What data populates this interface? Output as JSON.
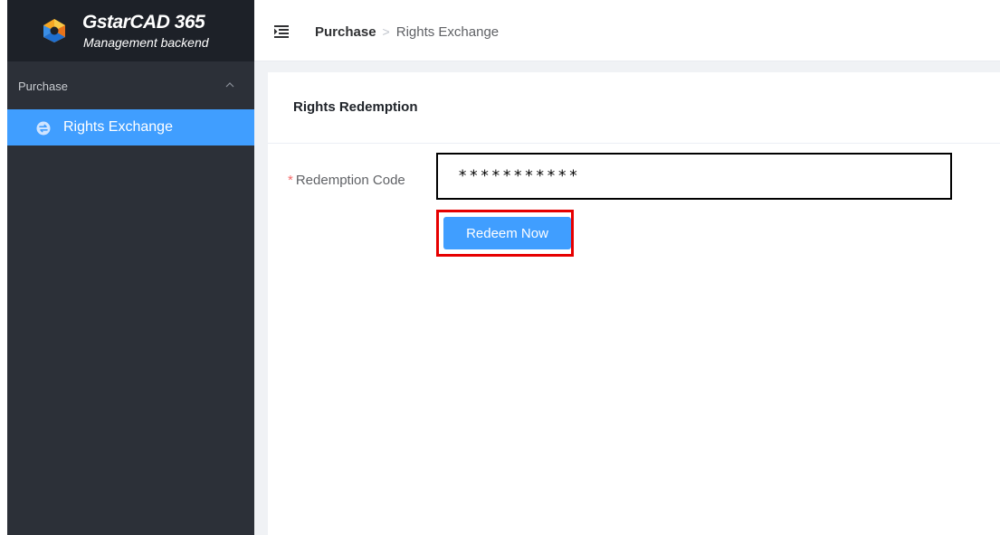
{
  "brand": {
    "title": "GstarCAD 365",
    "subtitle": "Management backend",
    "logo_icon": "gstarcad-logo-icon"
  },
  "sidebar": {
    "group": {
      "label": "Purchase",
      "icon": "chevron-up-icon",
      "expanded": true
    },
    "items": [
      {
        "label": "Rights Exchange",
        "icon": "exchange-icon",
        "active": true
      }
    ]
  },
  "header": {
    "menu_icon": "menu-fold-icon",
    "breadcrumb": {
      "root": "Purchase",
      "separator": ">",
      "current": "Rights Exchange"
    }
  },
  "card": {
    "title": "Rights Redemption"
  },
  "form": {
    "required_mark": "*",
    "code_label": "Redemption Code",
    "code_value": "***********",
    "submit_label": "Redeem Now"
  },
  "colors": {
    "sidebar_bg": "#2c3038",
    "brand_bg": "#1d2128",
    "accent": "#409eff",
    "highlight": "#e60000",
    "required": "#f56c6c"
  }
}
